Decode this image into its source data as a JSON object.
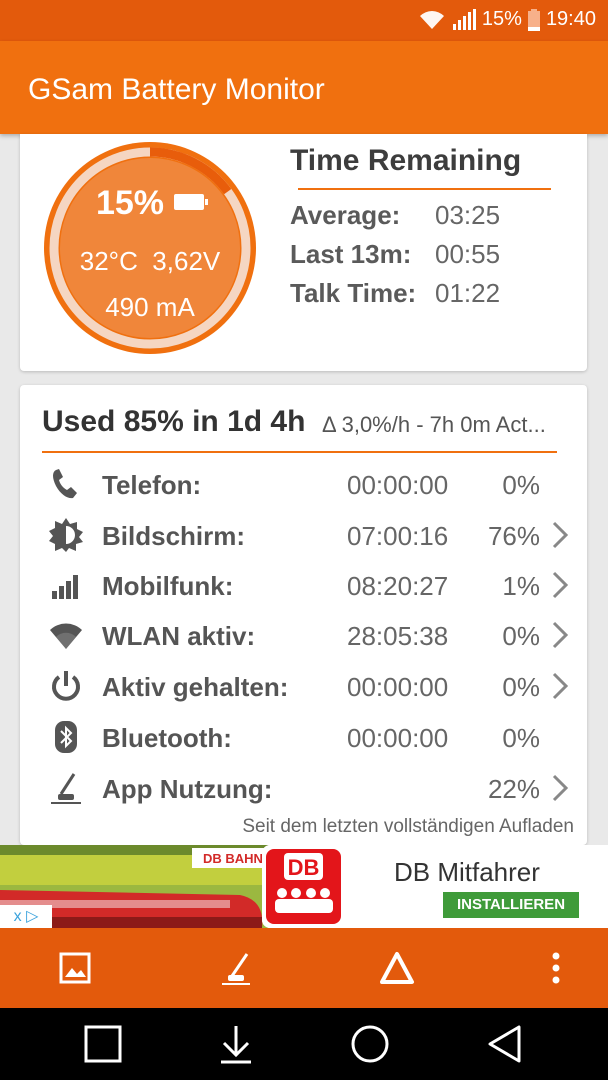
{
  "status_bar": {
    "battery_percent": "15%",
    "time": "19:40"
  },
  "app": {
    "title": "GSam Battery Monitor"
  },
  "battery": {
    "percent": "15%",
    "charge_level": 0.15,
    "temperature": "32°C",
    "voltage": "3,62V",
    "current": "490 mA"
  },
  "time_remaining": {
    "title": "Time Remaining",
    "rows": [
      {
        "label": "Average:",
        "value": "03:25"
      },
      {
        "label": "Last 13m:",
        "value": "00:55"
      },
      {
        "label": "Talk Time:",
        "value": "01:22"
      }
    ]
  },
  "usage": {
    "title": "Used 85% in 1d 4h",
    "subtitle": "Δ 3,0%/h - 7h 0m Act...",
    "rows": [
      {
        "icon": "phone-icon",
        "label": "Telefon:",
        "time": "00:00:00",
        "percent": "0%",
        "chevron": false
      },
      {
        "icon": "screen-brightness-icon",
        "label": "Bildschirm:",
        "time": "07:00:16",
        "percent": "76%",
        "chevron": true
      },
      {
        "icon": "cell-signal-icon",
        "label": "Mobilfunk:",
        "time": "08:20:27",
        "percent": "1%",
        "chevron": true
      },
      {
        "icon": "wifi-icon",
        "label": "WLAN aktiv:",
        "time": "28:05:38",
        "percent": "0%",
        "chevron": true
      },
      {
        "icon": "power-icon",
        "label": "Aktiv gehalten:",
        "time": "00:00:00",
        "percent": "0%",
        "chevron": true
      },
      {
        "icon": "bluetooth-icon",
        "label": "Bluetooth:",
        "time": "00:00:00",
        "percent": "0%",
        "chevron": false
      },
      {
        "icon": "app-usage-icon",
        "label": "App Nutzung:",
        "time": "",
        "percent": "22%",
        "chevron": true
      }
    ],
    "footer": "Seit dem letzten vollständigen Aufladen"
  },
  "ad": {
    "brand_small": "DB BAHN",
    "logo_text": "DB",
    "title": "DB Mitfahrer",
    "button": "INSTALLIEREN",
    "badge": "x ▷"
  },
  "toolbar": {
    "items": [
      "image-icon",
      "app-usage-icon",
      "triangle-icon",
      "more-vert-icon"
    ]
  },
  "nav": {
    "items": [
      "recents-icon",
      "download-icon",
      "home-icon",
      "back-icon"
    ]
  },
  "colors": {
    "accent": "#f0700f",
    "status": "#e35a0c",
    "ad_button": "#3f9b3a"
  }
}
